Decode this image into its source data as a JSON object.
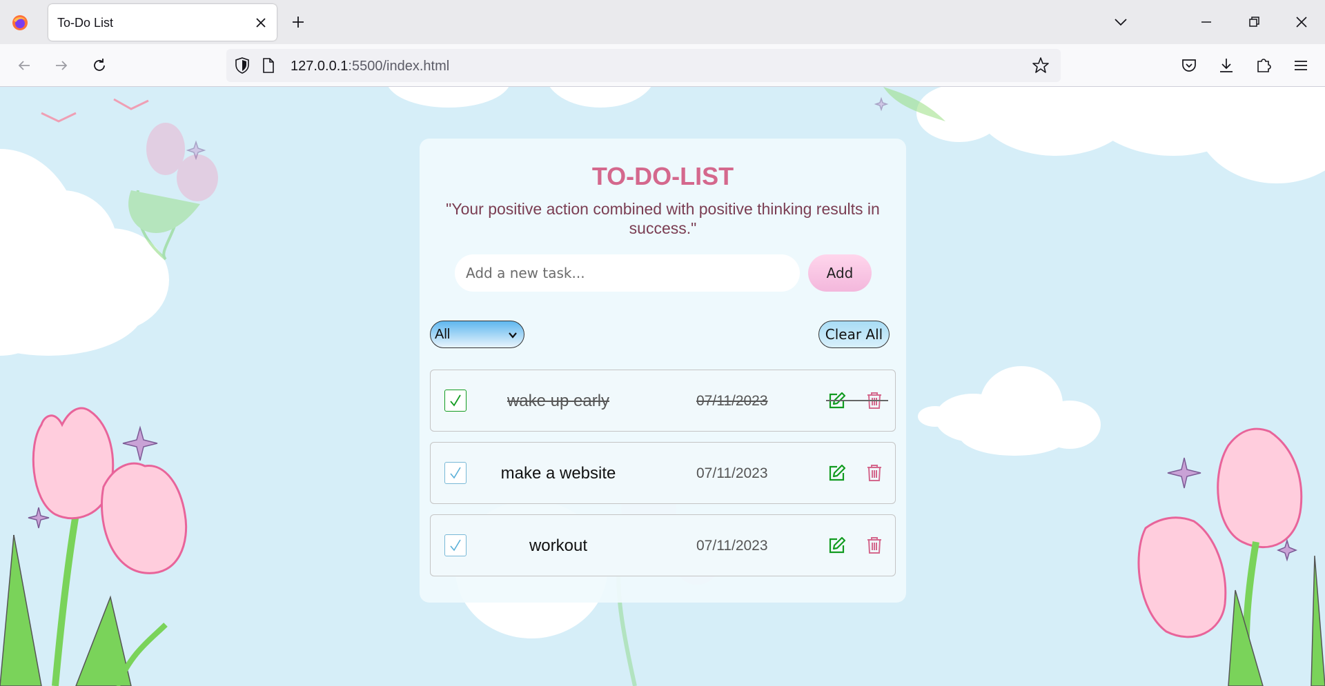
{
  "browser": {
    "tab_title": "To-Do List",
    "url_host": "127.0.0.1",
    "url_rest": ":5500/index.html",
    "icons": [
      "firefox-logo",
      "close-icon",
      "plus-icon",
      "chevron-down-icon",
      "minimize-icon",
      "restore-icon",
      "close-window-icon",
      "back-icon",
      "forward-icon",
      "reload-icon",
      "shield-icon",
      "page-icon",
      "star-icon",
      "pocket-icon",
      "download-icon",
      "extensions-icon",
      "menu-icon"
    ]
  },
  "app": {
    "title": "TO-DO-LIST",
    "quote": "\"Your positive action combined with positive thinking results in success.\"",
    "input_placeholder": "Add a new task...",
    "add_label": "Add",
    "filter_value": "All",
    "clear_label": "Clear All",
    "tasks": [
      {
        "text": "wake up early",
        "date": "07/11/2023",
        "done": true
      },
      {
        "text": "make a website",
        "date": "07/11/2023",
        "done": false
      },
      {
        "text": "workout",
        "date": "07/11/2023",
        "done": false
      }
    ]
  },
  "colors": {
    "title_pink": "#d4688d",
    "quote_plum": "#7a3d52",
    "edit_green": "#129b20",
    "trash_pink": "#d4688d",
    "sky": "#d6eef8"
  }
}
